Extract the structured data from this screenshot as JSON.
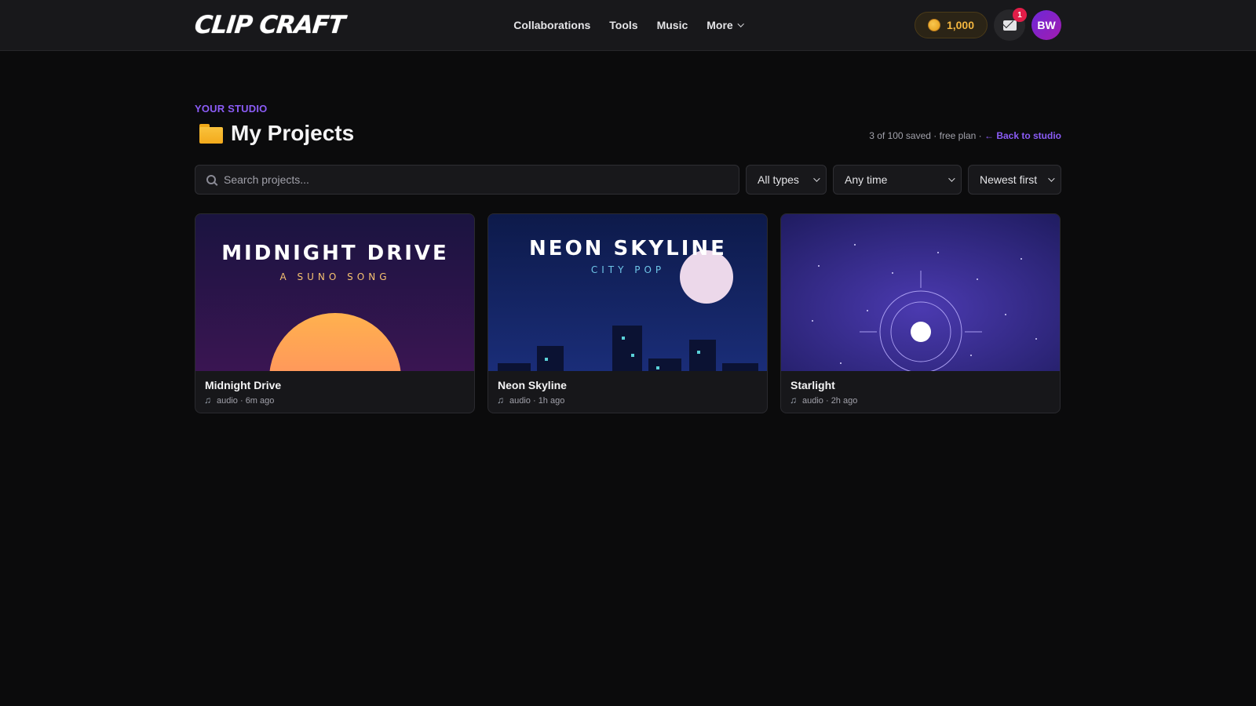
{
  "brand": {
    "logo_text": "CLIP CRAFT"
  },
  "nav": {
    "items": [
      "Collaborations",
      "Tools",
      "Music"
    ],
    "more_label": "More"
  },
  "header": {
    "coins": "1,000",
    "inbox_badge": "1",
    "avatar_initials": "BW"
  },
  "page": {
    "eyebrow": "YOUR STUDIO",
    "title": "My Projects",
    "meta_text": "3 of 100 saved · free plan · ",
    "back_link": "← Back to studio"
  },
  "filters": {
    "search_placeholder": "Search projects...",
    "type": "All types",
    "time": "Any time",
    "sort": "Newest first"
  },
  "projects": [
    {
      "title": "Midnight Drive",
      "meta": "audio · 6m ago",
      "art_title": "MIDNIGHT DRIVE",
      "art_subtitle": "A SUNO SONG"
    },
    {
      "title": "Neon Skyline",
      "meta": "audio · 1h ago",
      "art_title": "NEON SKYLINE",
      "art_subtitle": "CITY POP"
    },
    {
      "title": "Starlight",
      "meta": "audio · 2h ago"
    }
  ],
  "colors": {
    "accent": "#8b5cf6",
    "coin": "#f4b740",
    "badge": "#e11d48"
  }
}
